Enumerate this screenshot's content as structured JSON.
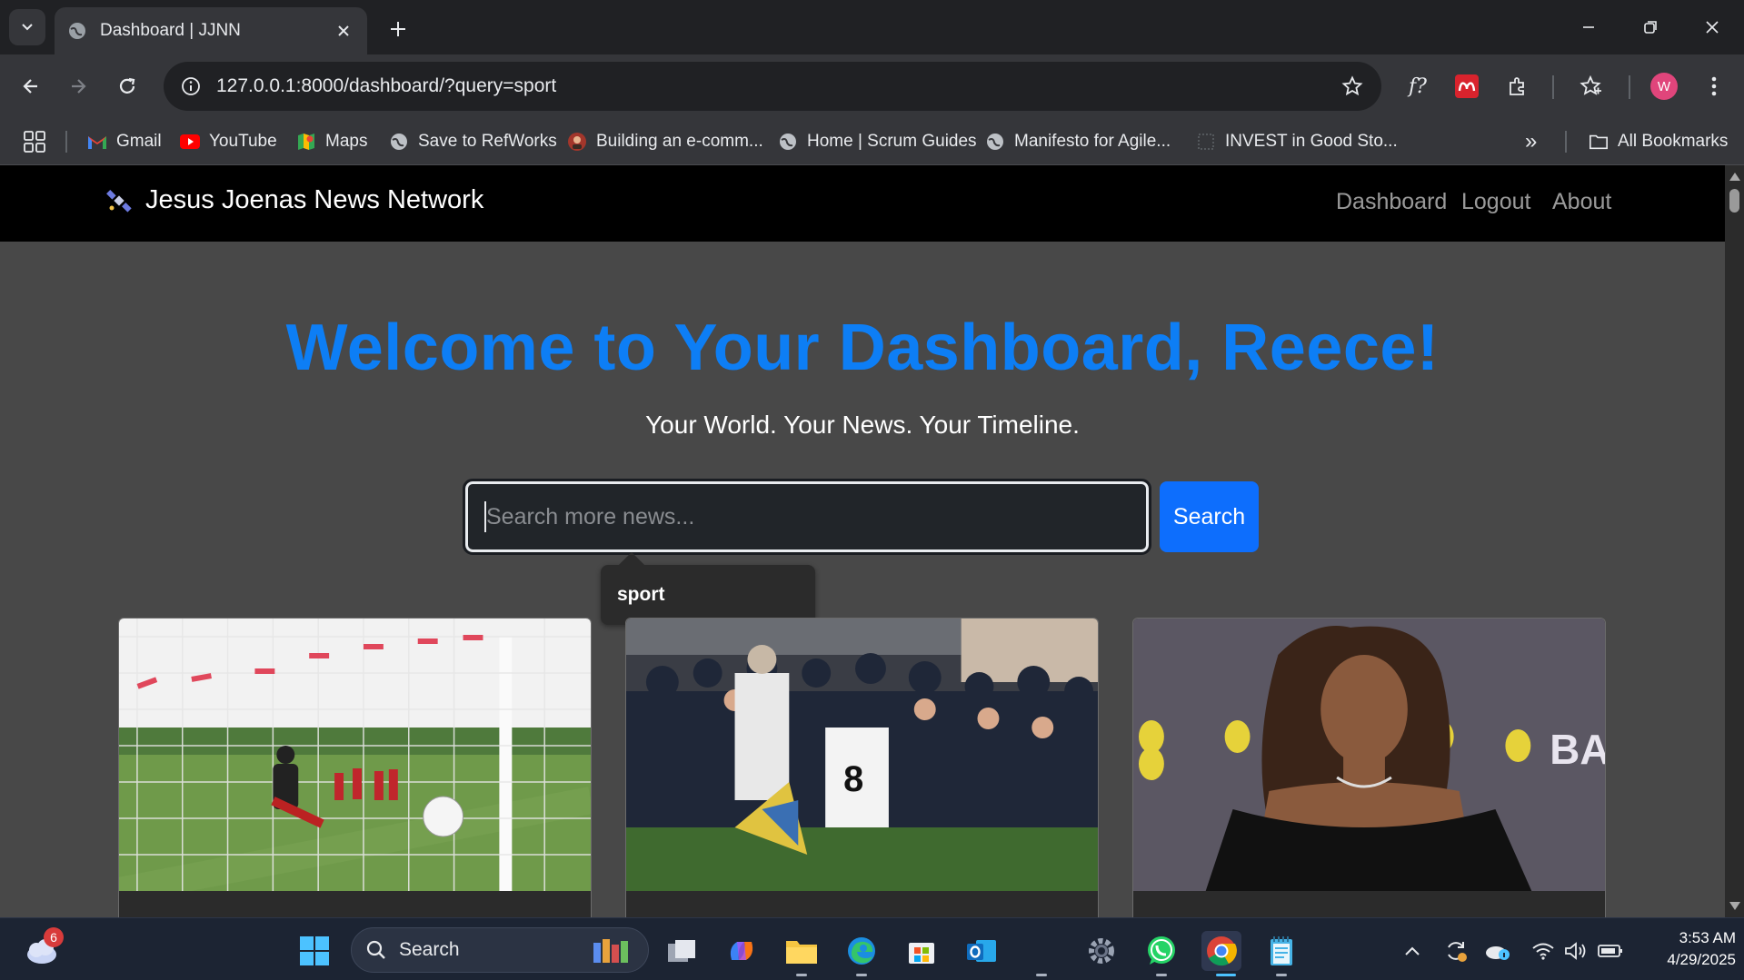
{
  "browser": {
    "tab_title": "Dashboard | JJNN",
    "url": "127.0.0.1:8000/dashboard/?query=sport",
    "profile_initial": "W",
    "bookmarks": [
      {
        "label": "Gmail",
        "icon": "gmail-icon"
      },
      {
        "label": "YouTube",
        "icon": "youtube-icon"
      },
      {
        "label": "Maps",
        "icon": "maps-icon"
      },
      {
        "label": "Save to RefWorks",
        "icon": "globe-icon"
      },
      {
        "label": "Building an e-comm...",
        "icon": "avatar-icon"
      },
      {
        "label": "Home | Scrum Guides",
        "icon": "globe-icon"
      },
      {
        "label": "Manifesto for Agile...",
        "icon": "globe-icon"
      },
      {
        "label": "INVEST in Good Sto...",
        "icon": "page-icon"
      }
    ],
    "overflow_label": "»",
    "all_bookmarks": "All Bookmarks"
  },
  "site": {
    "brand": "Jesus Joenas News Network",
    "nav": [
      "Dashboard",
      "Logout",
      "About"
    ],
    "hero_title": "Welcome to Your Dashboard, Reece!",
    "hero_subtitle": "Your World. Your News. Your Timeline.",
    "search_placeholder": "Search more news...",
    "search_button": "Search",
    "suggestion": "sport",
    "cards": [
      {
        "image": "football-goal-photo"
      },
      {
        "image": "football-fans-crowd-photo"
      },
      {
        "image": "film-awards-red-carpet-photo"
      }
    ],
    "accent_color": "#0d7ef5",
    "button_color": "#0d6efd"
  },
  "taskbar": {
    "weather_badge": "6",
    "search_label": "Search",
    "time": "3:53 AM",
    "date": "4/29/2025"
  }
}
